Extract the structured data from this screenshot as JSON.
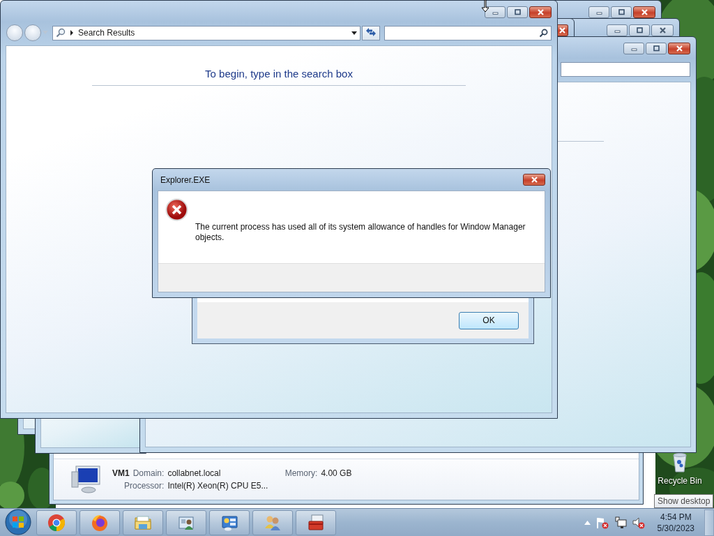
{
  "main_window": {
    "address": "Search Results",
    "message": "To begin, type in the search box"
  },
  "computer_window": {
    "computer_name": "VM1",
    "details": [
      {
        "label": "Domain:",
        "value": "collabnet.local"
      },
      {
        "label": "Memory:",
        "value": "4.00 GB"
      },
      {
        "label": "Processor:",
        "value": "Intel(R) Xeon(R) CPU E5..."
      }
    ]
  },
  "dialog_behind": {
    "buttons": [
      "OK"
    ]
  },
  "error_dialog": {
    "title": "Explorer.EXE",
    "message": "The current process has used all of its system allowance of handles for Window Manager objects."
  },
  "desktop_icons": [
    {
      "label": "Recycle Bin"
    }
  ],
  "tooltip": "Show desktop",
  "taskbar": {
    "clock": {
      "time": "4:54 PM",
      "date": "5/30/2023"
    }
  }
}
